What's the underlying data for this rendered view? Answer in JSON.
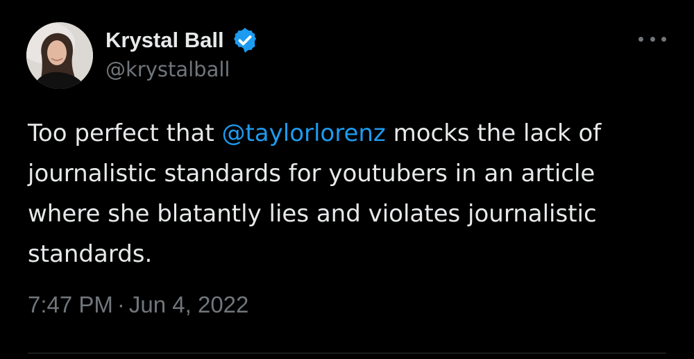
{
  "author": {
    "display_name": "Krystal Ball",
    "handle": "@krystalball",
    "verified": true,
    "verified_icon": "verified-badge-icon",
    "avatar_icon": "profile-photo"
  },
  "tweet": {
    "text_part1": "Too perfect that ",
    "mention": "@taylorlorenz",
    "text_part2": " mocks the lack of journalistic standards for youtubers in an article where she blatantly lies and violates journalistic standards.",
    "time": "7:47 PM",
    "separator": "·",
    "date": "Jun 4, 2022"
  },
  "menu": {
    "more_icon": "more-horizontal-icon"
  },
  "colors": {
    "background": "#000000",
    "text": "#e7e9ea",
    "muted": "#71767b",
    "accent": "#1d9bf0",
    "divider": "#2f3336"
  }
}
